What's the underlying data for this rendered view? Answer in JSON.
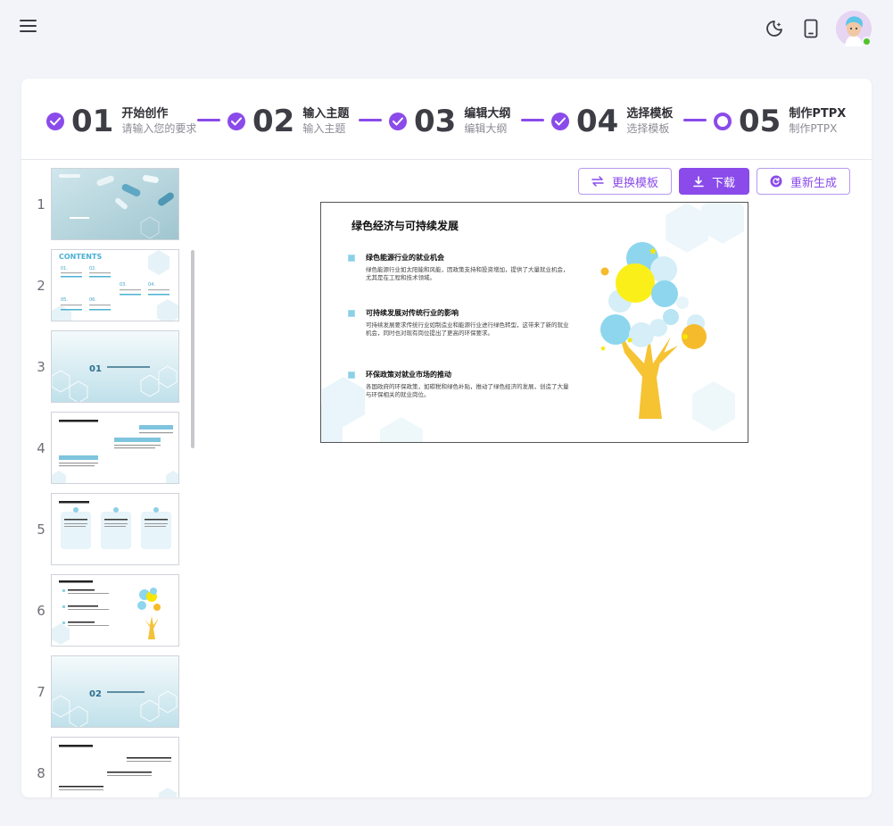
{
  "topbar": {
    "menu_icon": "hamburger-icon",
    "theme_icon": "moon-star-icon",
    "device_icon": "mobile-icon",
    "avatar": "user-avatar",
    "online_color": "#53c22b"
  },
  "accent_color": "#8a4bea",
  "steps": [
    {
      "num": "01",
      "title": "开始创作",
      "subtitle": "请输入您的要求",
      "status": "done"
    },
    {
      "num": "02",
      "title": "输入主题",
      "subtitle": "输入主题",
      "status": "done"
    },
    {
      "num": "03",
      "title": "编辑大纲",
      "subtitle": "编辑大纲",
      "status": "done"
    },
    {
      "num": "04",
      "title": "选择模板",
      "subtitle": "选择模板",
      "status": "done"
    },
    {
      "num": "05",
      "title": "制作PTPX",
      "subtitle": "制作PTPX",
      "status": "current"
    }
  ],
  "thumbnails": [
    {
      "num": "1"
    },
    {
      "num": "2",
      "heading": "CONTENTS",
      "items": [
        "01.",
        "02.",
        "03.",
        "04.",
        "05.",
        "06."
      ]
    },
    {
      "num": "3",
      "section": "01"
    },
    {
      "num": "4"
    },
    {
      "num": "5"
    },
    {
      "num": "6"
    },
    {
      "num": "7",
      "section": "02"
    },
    {
      "num": "8"
    }
  ],
  "toolbar": {
    "change_template": "更换模板",
    "download": "下载",
    "regenerate": "重新生成"
  },
  "slide": {
    "title": "绿色经济与可持续发展",
    "bullets": [
      {
        "title": "绿色能源行业的就业机会",
        "body": "绿色能源行业如太阳能和风能，因政策支持和投资增加，提供了大量就业机会，尤其是在工程和技术领域。"
      },
      {
        "title": "可持续发展对传统行业的影响",
        "body": "可持续发展要求传统行业如制造业和能源行业进行绿色转型，这带来了新的就业机会，同时也对现有岗位提出了更高的环保要求。"
      },
      {
        "title": "环保政策对就业市场的推动",
        "body": "各国政府的环保政策，如碳税和绿色补贴，推动了绿色经济的发展，创造了大量与环保相关的就业岗位。"
      }
    ]
  }
}
